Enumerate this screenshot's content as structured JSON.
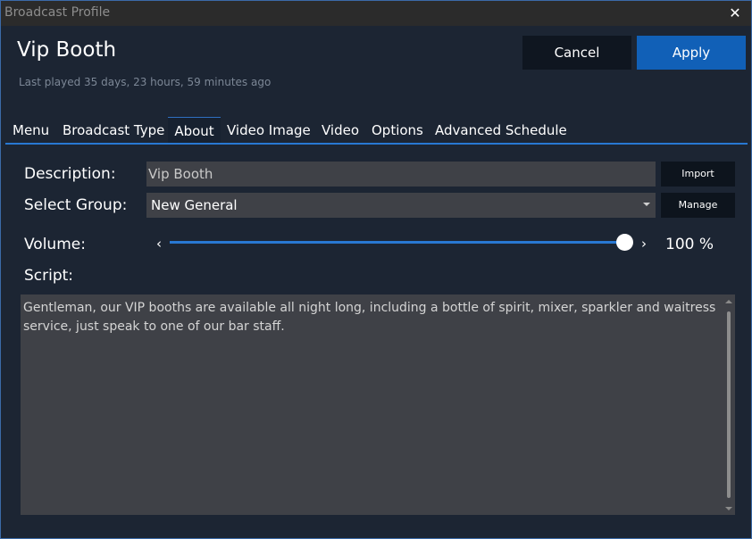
{
  "window": {
    "title": "Broadcast Profile",
    "close_glyph": "✕"
  },
  "header": {
    "title": "Vip Booth",
    "subtitle": "Last played 35 days, 23 hours, 59 minutes ago",
    "cancel_label": "Cancel",
    "apply_label": "Apply"
  },
  "tabs": [
    {
      "label": "Menu",
      "active": false
    },
    {
      "label": "Broadcast Type",
      "active": false
    },
    {
      "label": "About",
      "active": true
    },
    {
      "label": "Video Image",
      "active": false
    },
    {
      "label": "Video",
      "active": false
    },
    {
      "label": "Options",
      "active": false
    },
    {
      "label": "Advanced Schedule",
      "active": false
    }
  ],
  "form": {
    "description_label": "Description:",
    "description_value": "Vip Booth",
    "import_label": "Import",
    "group_label": "Select Group:",
    "group_value": "New General",
    "manage_label": "Manage",
    "volume_label": "Volume:",
    "volume_level": 1.0,
    "volume_value": "100 %",
    "volume_left_glyph": "‹",
    "volume_right_glyph": "›",
    "script_label": "Script:",
    "script_text": "Gentleman, our VIP booths are available all night long, including a bottle of spirit, mixer, sparkler and waitress service, just speak to one of our bar staff."
  },
  "colors": {
    "accent": "#2878d2",
    "apply_button": "#1160b7",
    "background": "#1c2533",
    "field": "#3f4147"
  },
  "icons": {
    "close": "close-icon",
    "dropdown": "chevron-down-icon",
    "volume_left": "chevron-left-icon",
    "volume_right": "chevron-right-icon"
  }
}
